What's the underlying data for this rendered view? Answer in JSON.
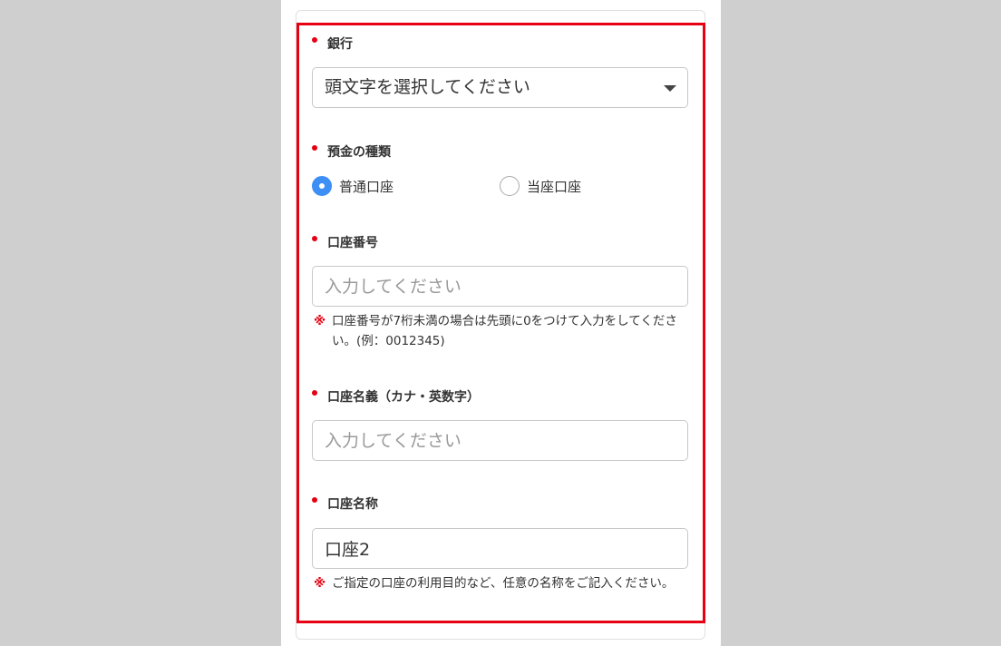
{
  "fields": {
    "bank": {
      "label": "銀行",
      "selected": "頭文字を選択してください"
    },
    "account_type": {
      "label": "預金の種類",
      "options": [
        {
          "label": "普通口座",
          "checked": true
        },
        {
          "label": "当座口座",
          "checked": false
        }
      ]
    },
    "account_number": {
      "label": "口座番号",
      "placeholder": "入力してください",
      "note_mark": "※",
      "note": "口座番号が7桁未満の場合は先頭に0をつけて入力をしてください。(例：0012345)"
    },
    "account_holder": {
      "label": "口座名義（カナ・英数字）",
      "placeholder": "入力してください"
    },
    "account_name": {
      "label": "口座名称",
      "value": "口座2",
      "note_mark": "※",
      "note": "ご指定の口座の利用目的など、任意の名称をご記入ください。"
    }
  },
  "colors": {
    "required": "#e60012",
    "highlight": "#e60012",
    "radio_checked": "#3d8ff5",
    "background": "#d0cfd0"
  }
}
